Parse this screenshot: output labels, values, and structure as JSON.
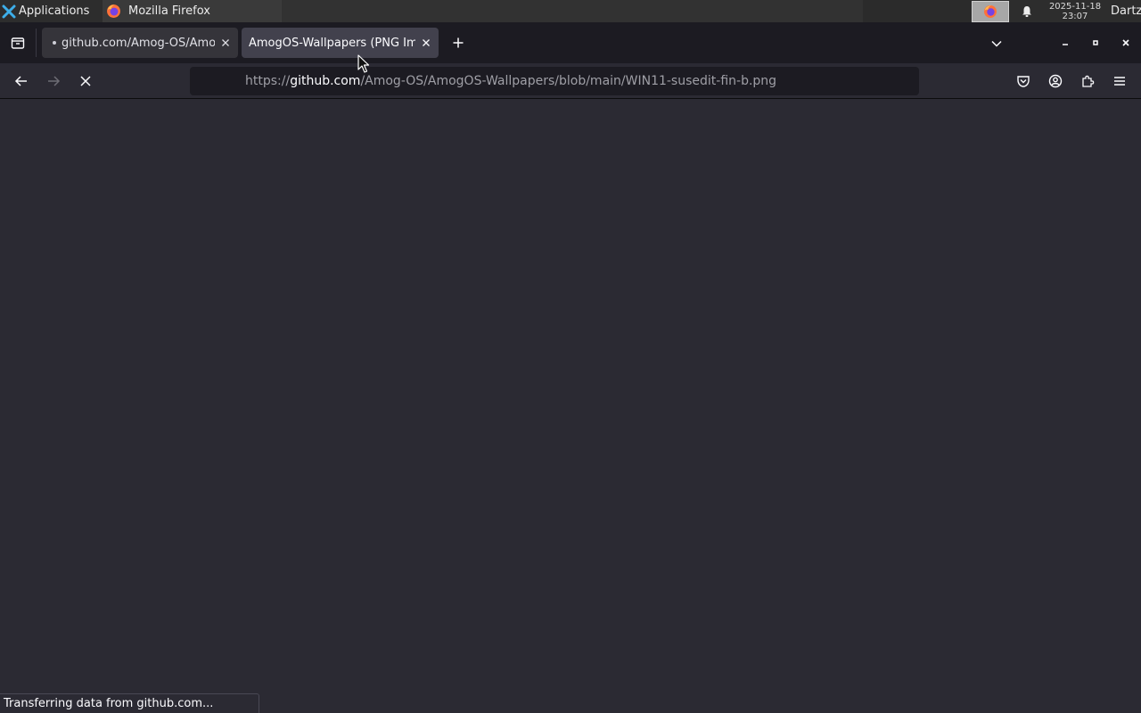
{
  "taskbar": {
    "applications_label": "Applications",
    "active_window_label": "Mozilla Firefox",
    "clock_date": "2025-11-18",
    "clock_time": "23:07",
    "user_name": "Dartz"
  },
  "tabs": [
    {
      "title": "github.com/Amog-OS/AmogOS-Wallpapers",
      "loading": true
    },
    {
      "title": "AmogOS-Wallpapers (PNG Image)",
      "active": true
    }
  ],
  "urlbar": {
    "scheme": "https://",
    "host": "github.com",
    "path": "/Amog-OS/AmogOS-Wallpapers/blob/main/WIN11-susedit-fin-b.png"
  },
  "status": {
    "text": "Transferring data from github.com..."
  },
  "colors": {
    "toolbar": "#2b2a33",
    "tabstrip": "#1c1b22",
    "active_tab": "#42414d",
    "content": "#2b2a33"
  }
}
